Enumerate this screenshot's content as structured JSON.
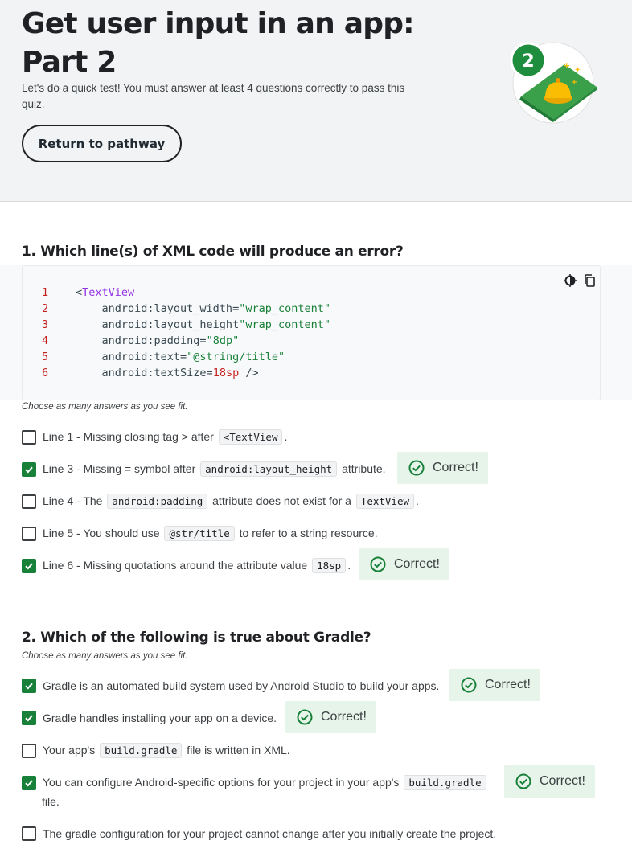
{
  "hero": {
    "title_line1": "Get user input in an app:",
    "title_line2": "Part 2",
    "description": "Let's do a quick test! You must answer at least 4 questions correctly to pass this quiz.",
    "return_label": "Return to pathway",
    "badge_number": "2"
  },
  "q1": {
    "title": "1. Which line(s) of XML code will produce an error?",
    "choose": "Choose as many answers as you see fit.",
    "code": {
      "lines": [
        {
          "n": "1",
          "parts": [
            {
              "t": "<",
              "c": "attr"
            },
            {
              "t": "TextView",
              "c": "tag"
            }
          ]
        },
        {
          "n": "2",
          "parts": [
            {
              "t": "    android:layout_width=",
              "c": "attr"
            },
            {
              "t": "\"wrap_content\"",
              "c": "str"
            }
          ]
        },
        {
          "n": "3",
          "parts": [
            {
              "t": "    android:layout_height",
              "c": "attr"
            },
            {
              "t": "\"wrap_content\"",
              "c": "str"
            }
          ]
        },
        {
          "n": "4",
          "parts": [
            {
              "t": "    android:padding=",
              "c": "attr"
            },
            {
              "t": "\"8dp\"",
              "c": "str"
            }
          ]
        },
        {
          "n": "5",
          "parts": [
            {
              "t": "    android:text=",
              "c": "attr"
            },
            {
              "t": "\"@string/title\"",
              "c": "str"
            }
          ]
        },
        {
          "n": "6",
          "parts": [
            {
              "t": "    android:textSize=",
              "c": "attr"
            },
            {
              "t": "18sp",
              "c": "num"
            },
            {
              "t": " />",
              "c": "attr"
            }
          ]
        }
      ]
    },
    "options": [
      {
        "pre": "Line 1 - Missing closing tag > after ",
        "code": "<TextView",
        "post": ".",
        "checked": false,
        "correct": ""
      },
      {
        "pre": "Line 3 - Missing = symbol after ",
        "code": "android:layout_height",
        "post": " attribute.",
        "checked": true,
        "correct": "Correct!"
      },
      {
        "pre": "Line 4 - The ",
        "code": "android:padding",
        "mid": " attribute does not exist for a ",
        "code2": "TextView",
        "post": ".",
        "checked": false,
        "correct": ""
      },
      {
        "pre": "Line 5 - You should use ",
        "code": "@str/title",
        "post": " to refer to a string resource.",
        "checked": false,
        "correct": ""
      },
      {
        "pre": "Line 6 - Missing quotations around the attribute value ",
        "code": "18sp",
        "post": ".",
        "checked": true,
        "correct": "Correct!"
      }
    ]
  },
  "q2": {
    "title": "2. Which of the following is true about Gradle?",
    "choose": "Choose as many answers as you see fit.",
    "options": [
      {
        "pre": "Gradle is an automated build system used by Android Studio to build your apps.",
        "checked": true,
        "correct": "Correct!"
      },
      {
        "pre": "Gradle handles installing your app on a device.",
        "checked": true,
        "correct": "Correct!"
      },
      {
        "pre": "Your app's ",
        "code": "build.gradle",
        "post": " file is written in XML.",
        "checked": false,
        "correct": ""
      },
      {
        "pre": "You can configure Android-specific options for your project in your app's ",
        "code": "build.gradle",
        "post2": "file.",
        "checked": true,
        "correct": "Correct!"
      },
      {
        "pre": "The gradle configuration for your project cannot change after you initially create the project.",
        "checked": false,
        "correct": ""
      }
    ]
  },
  "colors": {
    "accent_green": "#188038",
    "correct_bg": "#e6f4ea",
    "hero_bg": "#f1f3f4"
  },
  "icons": {
    "theme": "brightness-icon",
    "copy": "copy-icon",
    "check": "check-circle-icon"
  }
}
